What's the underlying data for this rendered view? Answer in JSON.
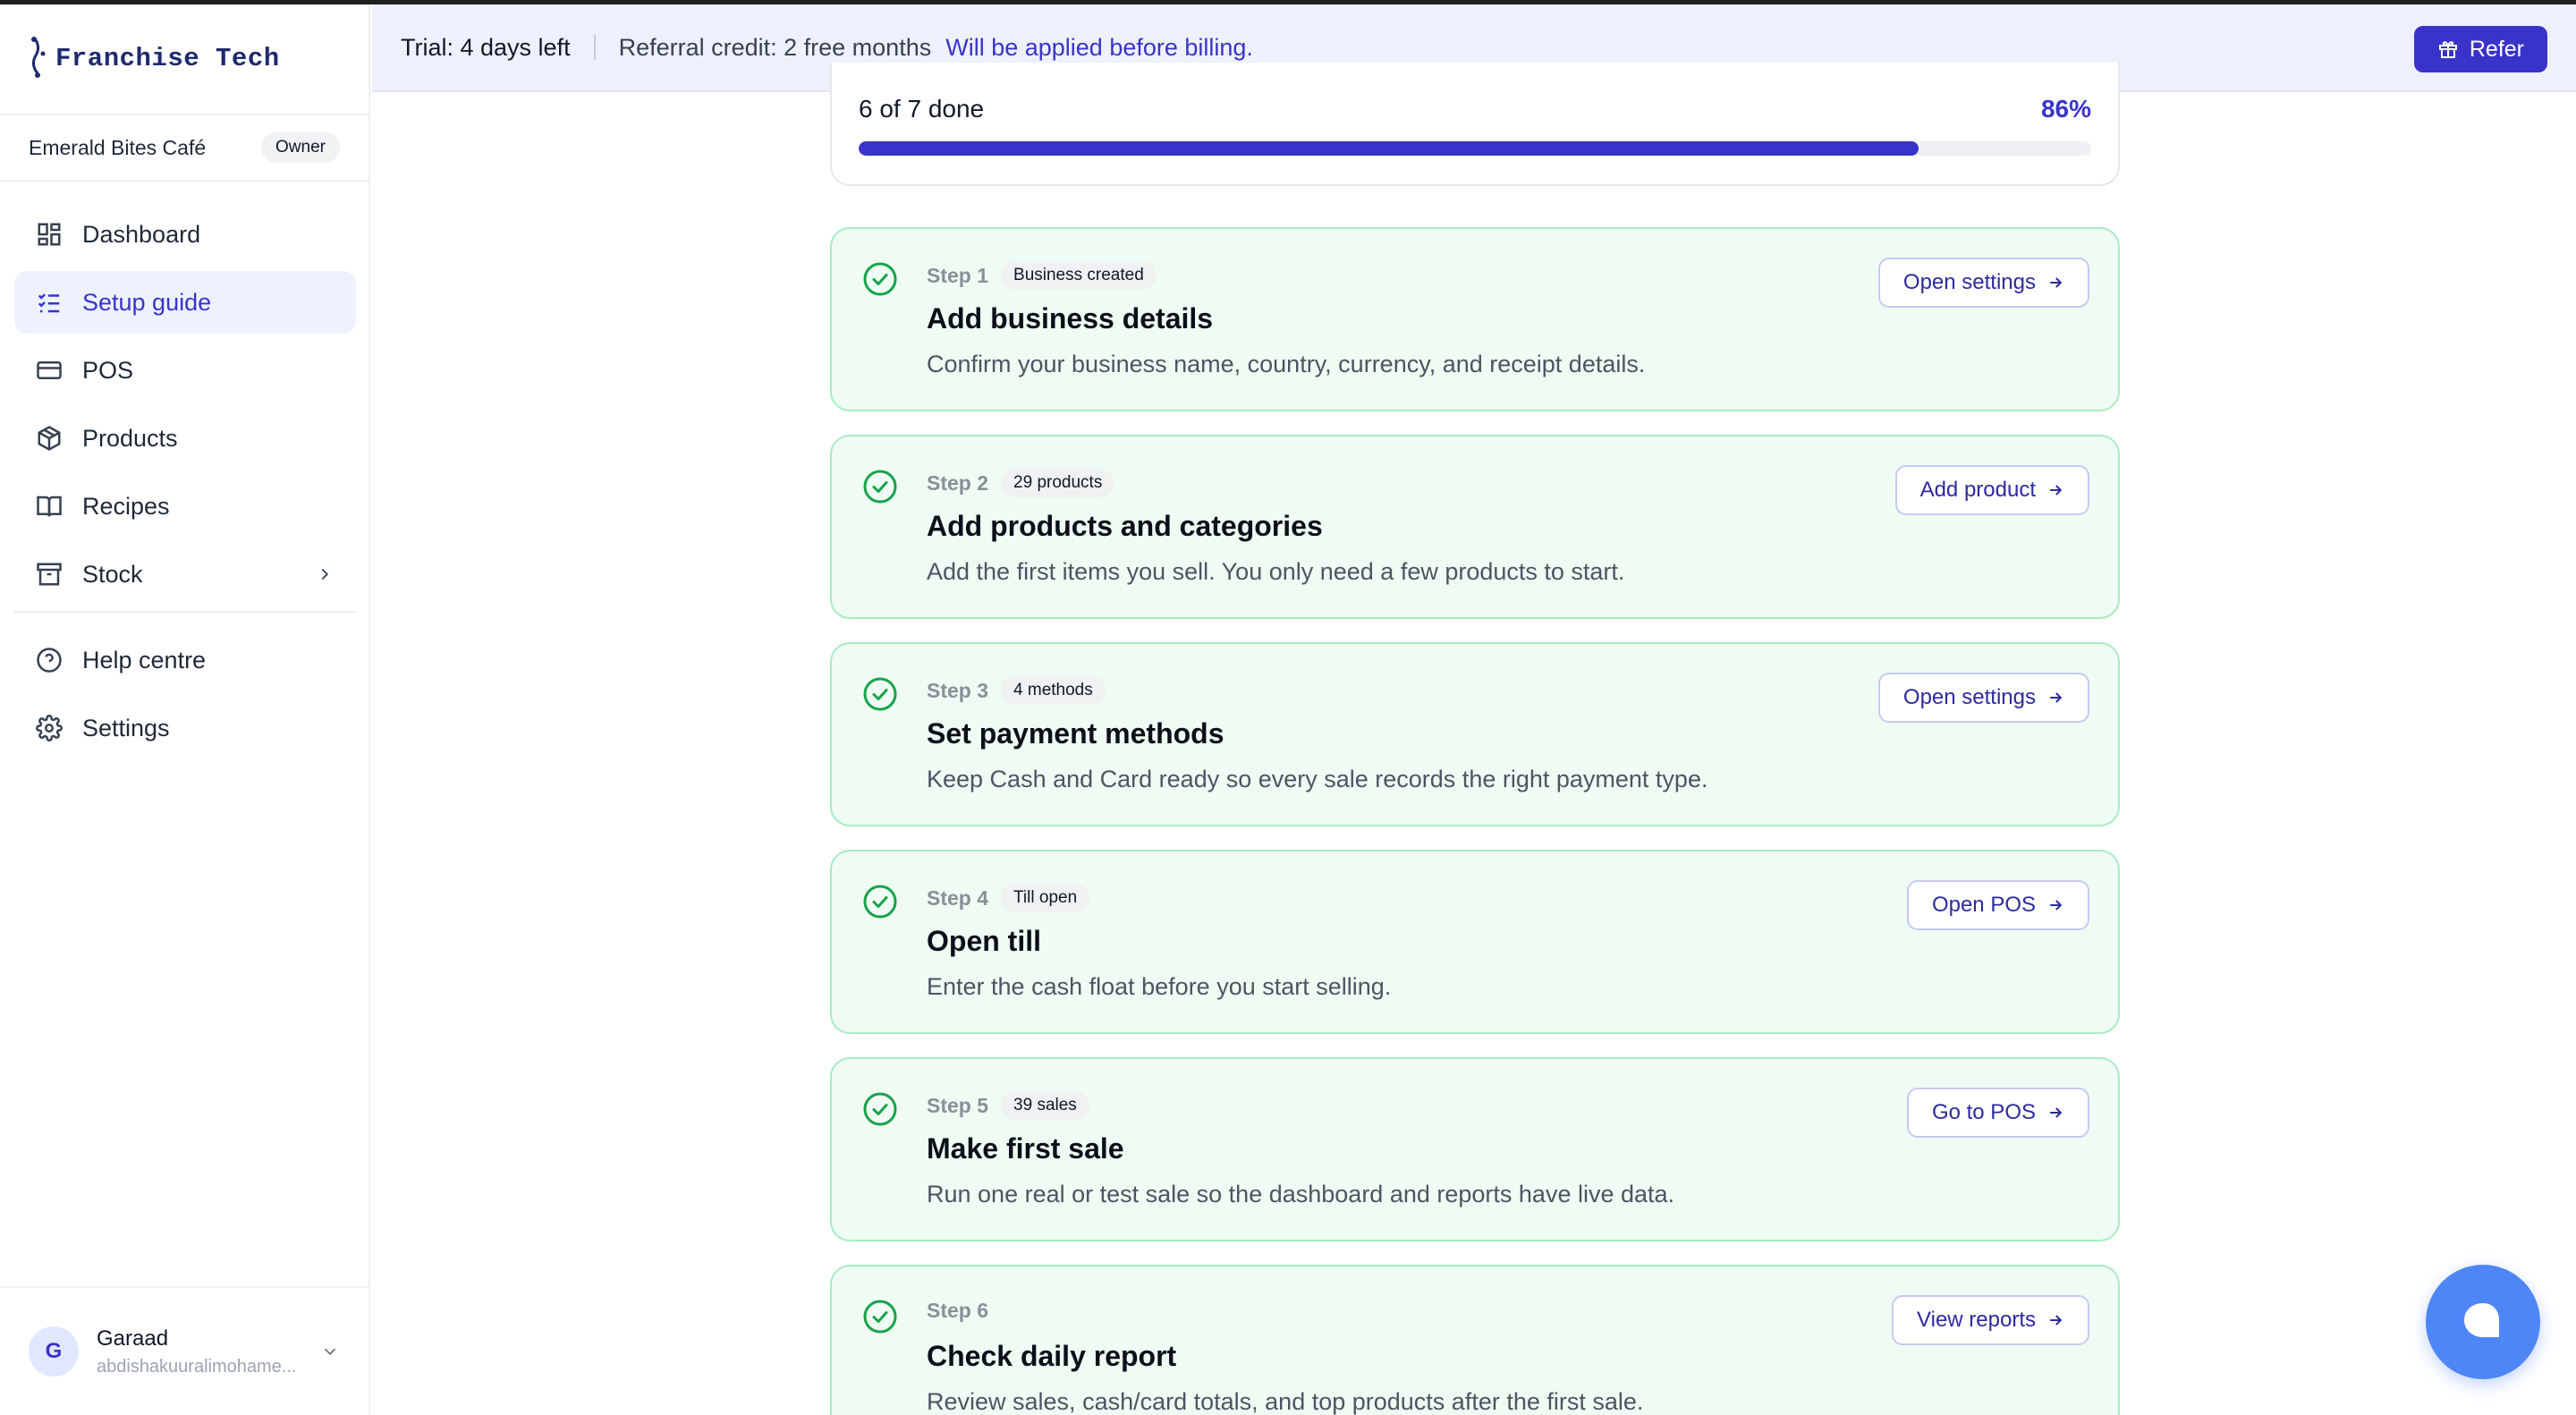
{
  "brand": {
    "name": "Franchise Tech"
  },
  "business": {
    "name": "Emerald Bites Café",
    "role": "Owner"
  },
  "nav": {
    "items": [
      {
        "label": "Dashboard",
        "icon": "dashboard-icon"
      },
      {
        "label": "Setup guide",
        "icon": "checklist-icon",
        "active": true
      },
      {
        "label": "POS",
        "icon": "card-icon"
      },
      {
        "label": "Products",
        "icon": "box-icon"
      },
      {
        "label": "Recipes",
        "icon": "book-icon"
      },
      {
        "label": "Stock",
        "icon": "archive-icon",
        "expandable": true
      }
    ],
    "secondary": [
      {
        "label": "Help centre",
        "icon": "help-icon"
      },
      {
        "label": "Settings",
        "icon": "gear-icon"
      }
    ]
  },
  "user": {
    "initial": "G",
    "name": "Garaad",
    "email": "abdishakuuralimohame..."
  },
  "banner": {
    "trial": "Trial: 4 days left",
    "credit": "Referral credit: 2 free months",
    "credit_note": "Will be applied before billing.",
    "refer_label": "Refer"
  },
  "progress": {
    "text": "6 of 7 done",
    "percent_label": "86%",
    "fraction": 0.86
  },
  "steps": [
    {
      "step": "Step 1",
      "badge": "Business created",
      "title": "Add business details",
      "desc": "Confirm your business name, country, currency, and receipt details.",
      "button": "Open settings"
    },
    {
      "step": "Step 2",
      "badge": "29 products",
      "title": "Add products and categories",
      "desc": "Add the first items you sell. You only need a few products to start.",
      "button": "Add product"
    },
    {
      "step": "Step 3",
      "badge": "4 methods",
      "title": "Set payment methods",
      "desc": "Keep Cash and Card ready so every sale records the right payment type.",
      "button": "Open settings"
    },
    {
      "step": "Step 4",
      "badge": "Till open",
      "title": "Open till",
      "desc": "Enter the cash float before you start selling.",
      "button": "Open POS"
    },
    {
      "step": "Step 5",
      "badge": "39 sales",
      "title": "Make first sale",
      "desc": "Run one real or test sale so the dashboard and reports have live data.",
      "button": "Go to POS"
    },
    {
      "step": "Step 6",
      "badge": "",
      "title": "Check daily report",
      "desc": "Review sales, cash/card totals, and top products after the first sale.",
      "button": "View reports"
    }
  ],
  "colors": {
    "accent": "#3a33c9",
    "success": "#16a34a",
    "step_bg": "#effcf3",
    "chat": "#4f86f7"
  }
}
